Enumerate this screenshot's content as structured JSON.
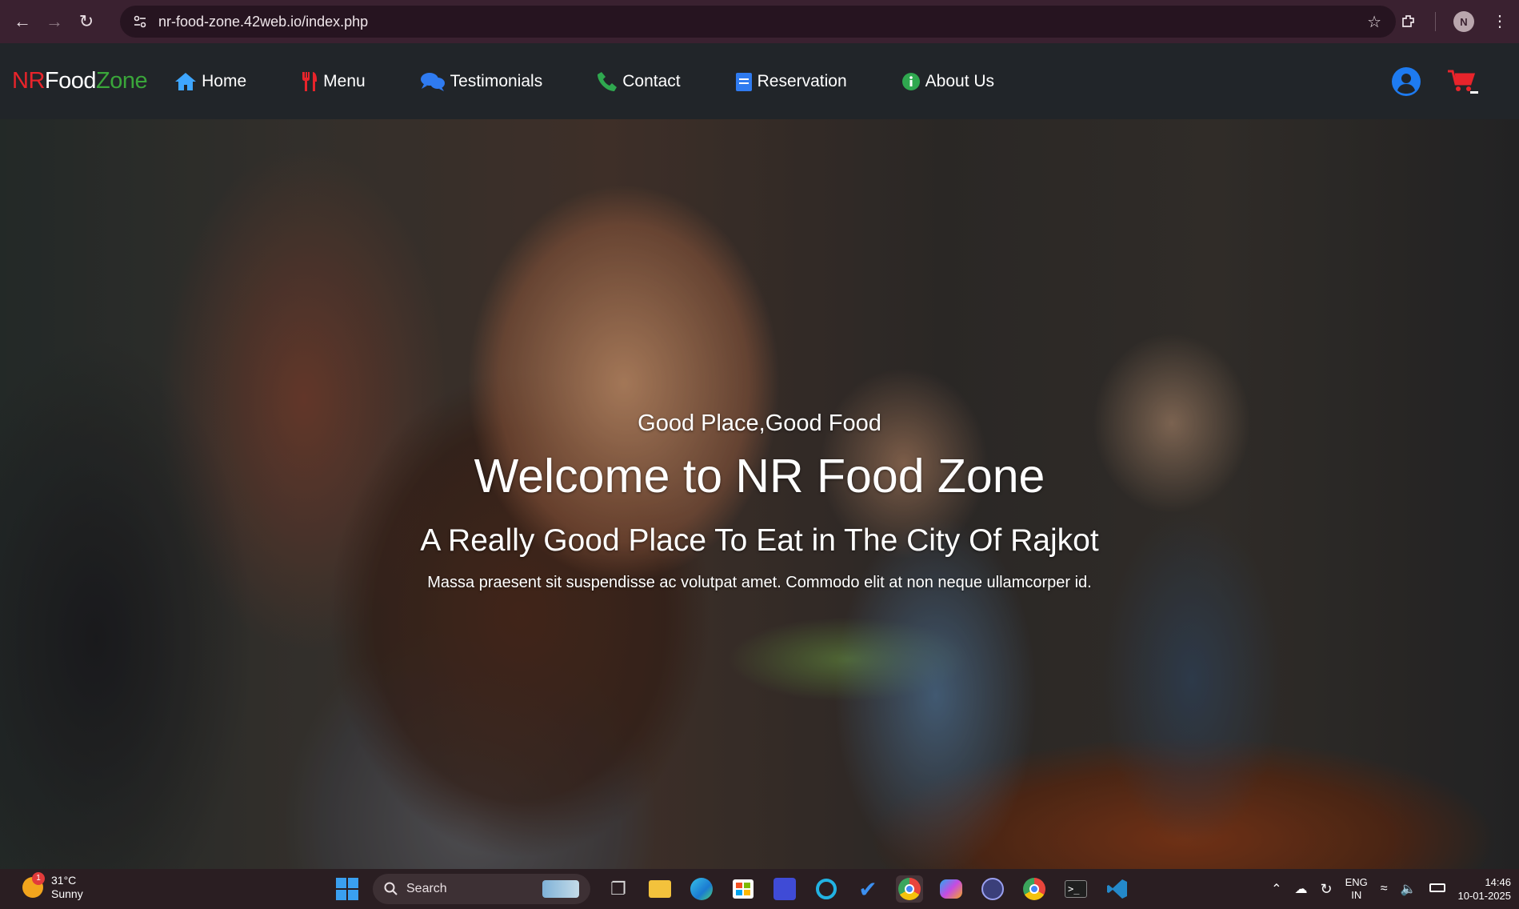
{
  "browser": {
    "url": "nr-food-zone.42web.io/index.php",
    "profile_initial": "N"
  },
  "site": {
    "brand": {
      "nr": "NR",
      "food": "Food",
      "zone": "Zone"
    },
    "nav": [
      {
        "label": "Home",
        "icon": "home-icon",
        "color": "#3ea6ff"
      },
      {
        "label": "Menu",
        "icon": "fork-knife-icon",
        "color": "#e8242b"
      },
      {
        "label": "Testimonials",
        "icon": "chat-bubbles-icon",
        "color": "#2f7bf0"
      },
      {
        "label": "Contact",
        "icon": "phone-icon",
        "color": "#2fa84f"
      },
      {
        "label": "Reservation",
        "icon": "clipboard-icon",
        "color": "#2f7bf0"
      },
      {
        "label": "About Us",
        "icon": "info-icon",
        "color": "#2fa84f"
      }
    ],
    "user_icon_color": "#1e7bf0",
    "cart_icon_color": "#e8242b"
  },
  "hero": {
    "tagline": "Good Place,Good Food",
    "title": "Welcome to NR Food Zone",
    "subtitle": "A Really Good Place To Eat in The City Of Rajkot",
    "description": "Massa praesent sit suspendisse ac volutpat amet. Commodo elit at non neque ullamcorper id."
  },
  "taskbar": {
    "weather_temp": "31°C",
    "weather_desc": "Sunny",
    "weather_badge": "1",
    "search_placeholder": "Search",
    "language_top": "ENG",
    "language_bottom": "IN",
    "time": "14:46",
    "date": "10-01-2025"
  }
}
